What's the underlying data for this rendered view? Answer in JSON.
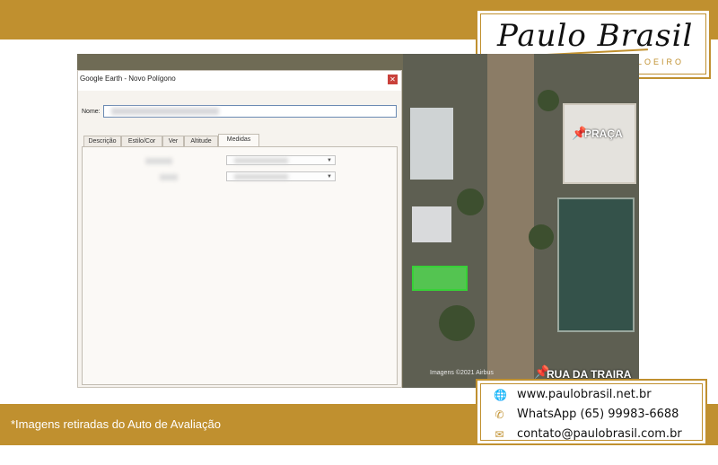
{
  "brand": {
    "logo_text": "Paulo Brasil",
    "logo_sub": "LEILOEIRO"
  },
  "dialog": {
    "title": "Google Earth - Novo Polígono",
    "close_icon": "close-icon",
    "name_label": "Nome:",
    "tabs": [
      {
        "label": "Descrição"
      },
      {
        "label": "Estilo/Cor"
      },
      {
        "label": "Ver"
      },
      {
        "label": "Altitude"
      },
      {
        "label": "Medidas"
      }
    ],
    "active_tab": "Medidas"
  },
  "map": {
    "labels": {
      "praca": "PRAÇA",
      "street": "RUA DA TRAIRA",
      "credit": "Imagens ©2021 Airbus"
    },
    "pin_icon": "pushpin-icon"
  },
  "caption": "*Imagens retiradas do Auto de Avaliação",
  "contact": {
    "website": "www.paulobrasil.net.br",
    "whatsapp": "WhatsApp (65) 99983-6688",
    "email": "contato@paulobrasil.com.br",
    "icons": [
      "globe-icon",
      "phone-icon",
      "mail-icon"
    ]
  },
  "colors": {
    "gold": "#c0902f",
    "parcel": "#52e652"
  }
}
